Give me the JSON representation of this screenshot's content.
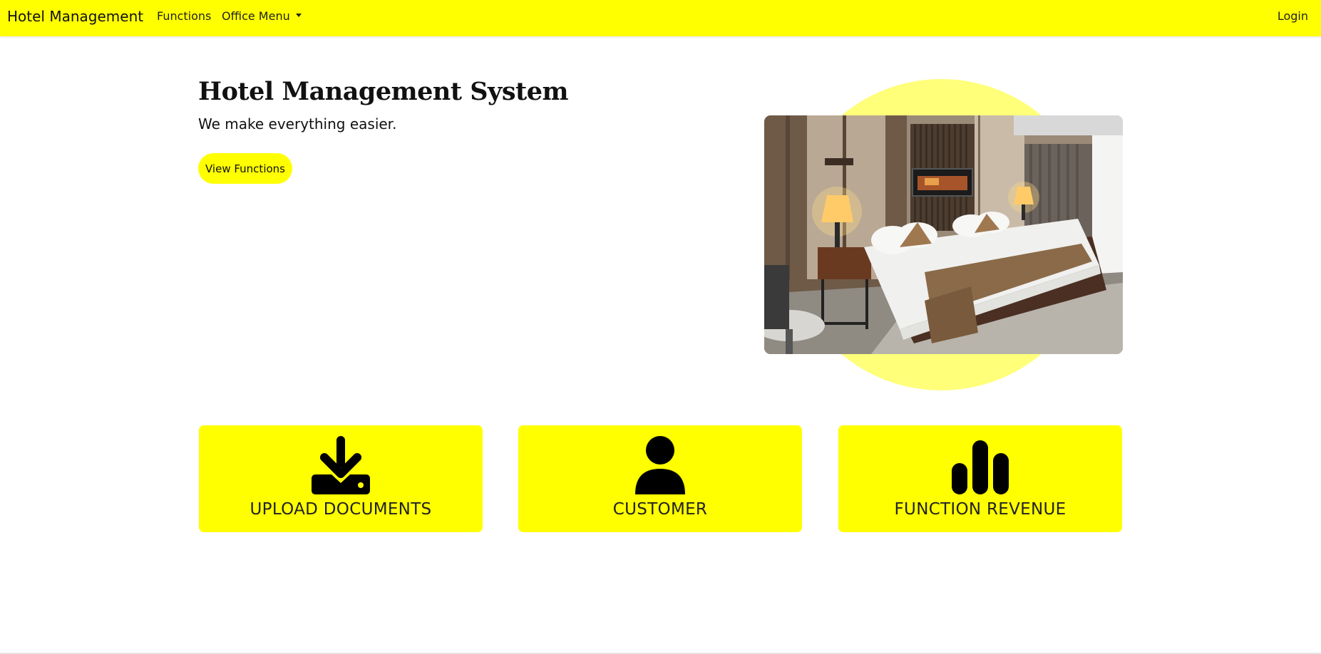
{
  "navbar": {
    "brand": "Hotel Management",
    "functions_label": "Functions",
    "office_menu_label": "Office Menu",
    "login_label": "Login"
  },
  "hero": {
    "title": "Hotel Management System",
    "subtitle": "We make everything easier.",
    "button_label": "View Functions",
    "image_icon": "hotel-bedroom-photo"
  },
  "cards": [
    {
      "label": "UPLOAD DOCUMENTS",
      "icon": "download-icon"
    },
    {
      "label": "CUSTOMER",
      "icon": "user-icon"
    },
    {
      "label": "FUNCTION REVENUE",
      "icon": "bar-chart-icon"
    }
  ],
  "colors": {
    "accent": "#ffff00",
    "accent_light": "#ffff7a",
    "text": "#111111"
  }
}
